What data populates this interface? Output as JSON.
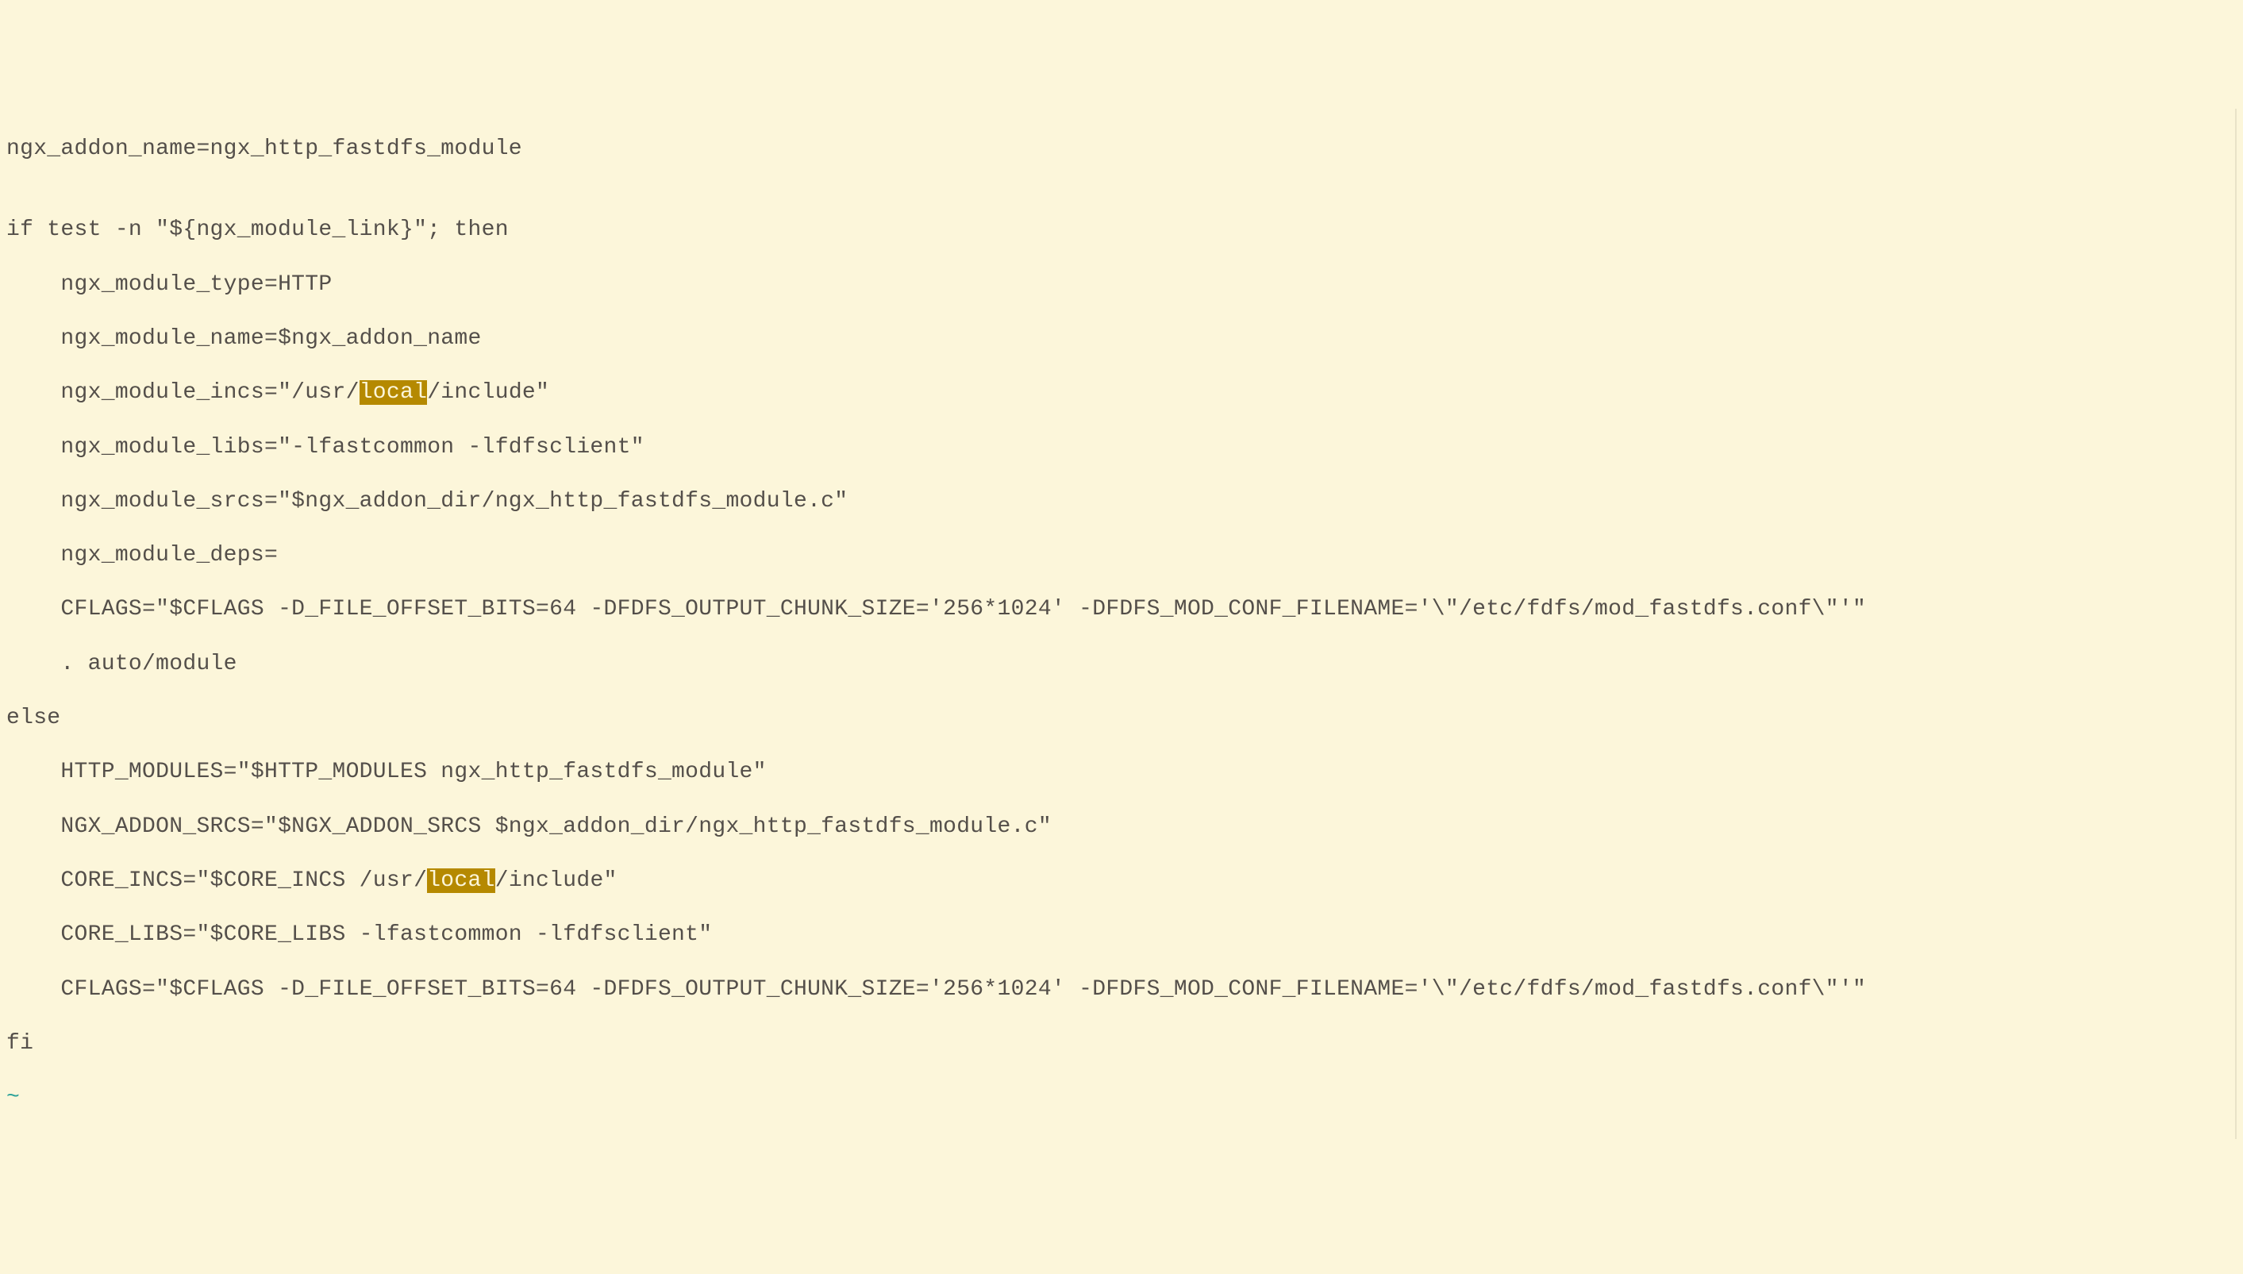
{
  "code": {
    "line1": "ngx_addon_name=ngx_http_fastdfs_module",
    "line2": "",
    "line3": "if test -n \"${ngx_module_link}\"; then",
    "line4": "    ngx_module_type=HTTP",
    "line5": "    ngx_module_name=$ngx_addon_name",
    "line6_pre": "    ngx_module_incs=\"/usr/",
    "line6_hl": "local",
    "line6_post": "/include\"",
    "line7": "    ngx_module_libs=\"-lfastcommon -lfdfsclient\"",
    "line8": "    ngx_module_srcs=\"$ngx_addon_dir/ngx_http_fastdfs_module.c\"",
    "line9": "    ngx_module_deps=",
    "line10": "    CFLAGS=\"$CFLAGS -D_FILE_OFFSET_BITS=64 -DFDFS_OUTPUT_CHUNK_SIZE='256*1024' -DFDFS_MOD_CONF_FILENAME='\\\"/etc/fdfs/mod_fastdfs.conf\\\"'\"",
    "line11": "    . auto/module",
    "line12": "else",
    "line13": "    HTTP_MODULES=\"$HTTP_MODULES ngx_http_fastdfs_module\"",
    "line14": "    NGX_ADDON_SRCS=\"$NGX_ADDON_SRCS $ngx_addon_dir/ngx_http_fastdfs_module.c\"",
    "line15_pre": "    CORE_INCS=\"$CORE_INCS /usr/",
    "line15_hl": "local",
    "line15_post": "/include\"",
    "line16": "    CORE_LIBS=\"$CORE_LIBS -lfastcommon -lfdfsclient\"",
    "line17": "    CFLAGS=\"$CFLAGS -D_FILE_OFFSET_BITS=64 -DFDFS_OUTPUT_CHUNK_SIZE='256*1024' -DFDFS_MOD_CONF_FILENAME='\\\"/etc/fdfs/mod_fastdfs.conf\\\"'\"",
    "line18": "fi",
    "tilde": "~"
  },
  "search_match": "local"
}
